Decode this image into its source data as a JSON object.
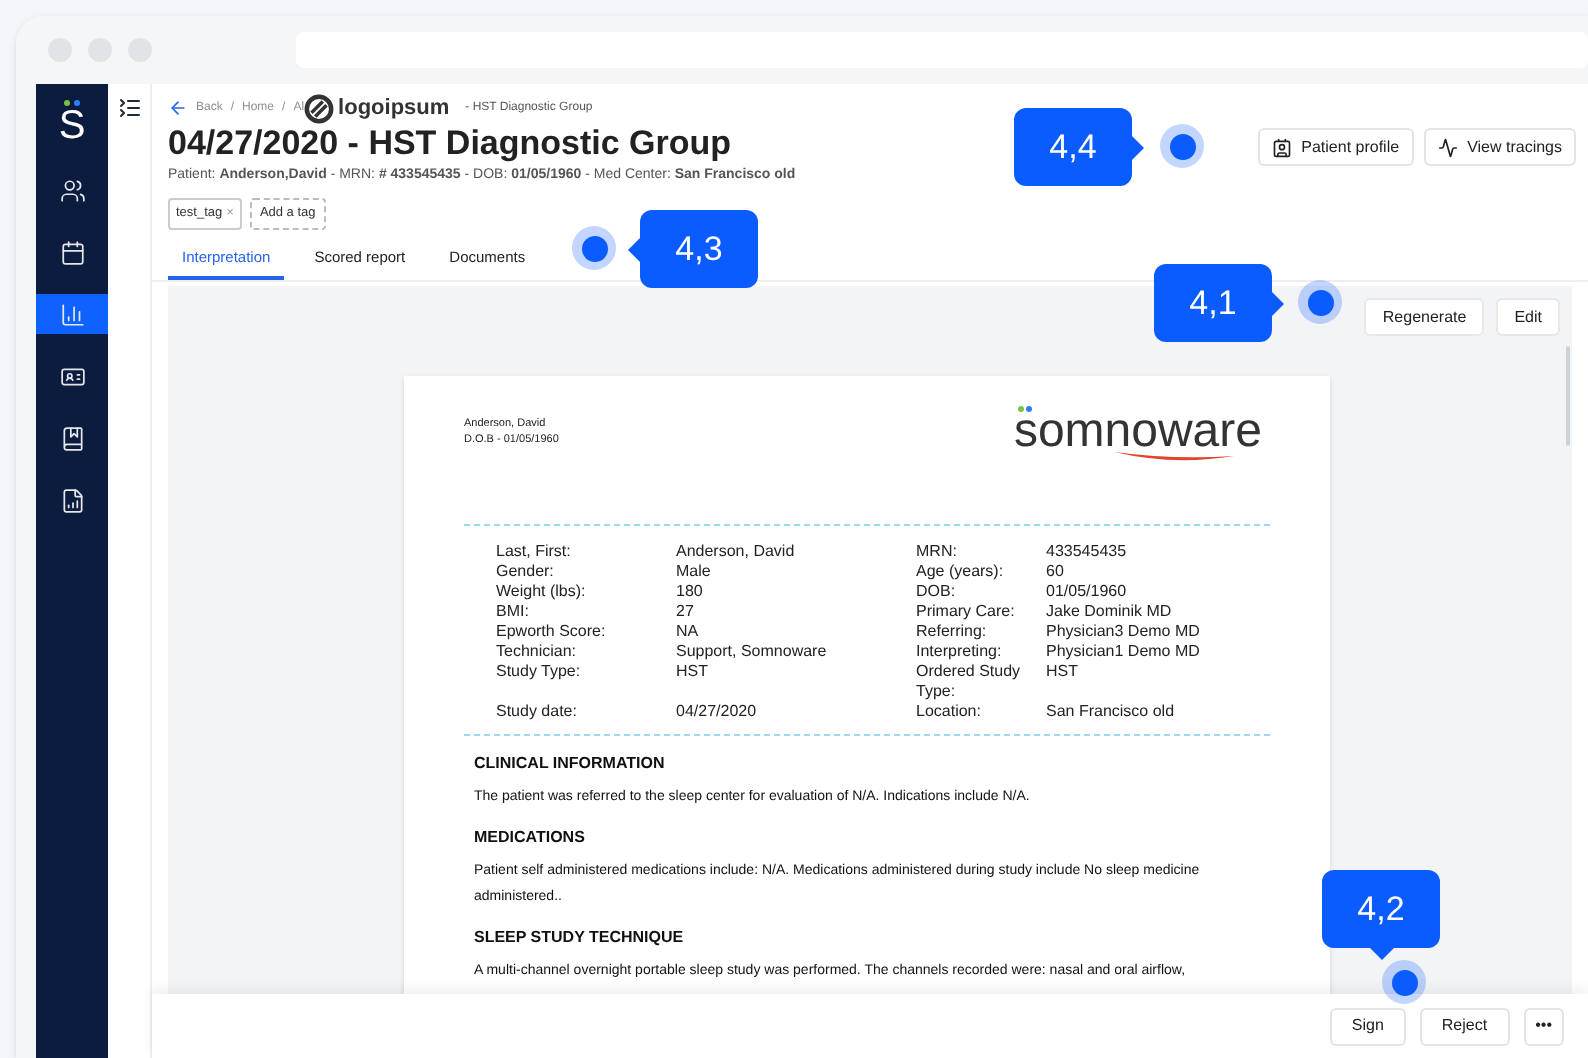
{
  "sidebar": {
    "logo_letter": "S",
    "items": [
      {
        "selected": false
      },
      {
        "selected": false
      },
      {
        "selected": true
      },
      {
        "selected": false
      },
      {
        "selected": false
      },
      {
        "selected": false
      }
    ]
  },
  "breadcrumb": {
    "back": "Back",
    "items": [
      {
        "separator": "/",
        "label": "Home"
      },
      {
        "separator": "/",
        "label": "Al"
      }
    ],
    "logo": "logoipsum",
    "tail": "- HST Diagnostic Group"
  },
  "title": "04/27/2020 - HST Diagnostic Group",
  "patient_line": "Patient: **Anderson,David** - MRN: **# 433545435** - DOB: **01/05/1960** - Med Center: **San Francisco old**",
  "tags": [
    {
      "label": "test_tag",
      "remove": "×"
    }
  ],
  "add_tag": "Add a tag",
  "header_buttons": [
    "Patient profile",
    "View tracings"
  ],
  "tabs": [
    {
      "label": "Interpretation",
      "selected": true
    },
    {
      "label": "Scored report",
      "selected": false
    },
    {
      "label": "Documents",
      "selected": false
    }
  ],
  "toolbar_buttons": [
    "Regenerate",
    "Edit"
  ],
  "report": {
    "patient_name": "Anderson, David",
    "dob": "D.O.B - 01/05/1960",
    "brand": "somnoware",
    "left_fields": [
      {
        "label": "Last, First:",
        "value": "Anderson, David"
      },
      {
        "label": "Gender:",
        "value": "Male"
      },
      {
        "label": "Weight (lbs):",
        "value": "180"
      },
      {
        "label": "BMI:",
        "value": "27"
      },
      {
        "label": "Epworth Score:",
        "value": "NA"
      },
      {
        "label": "Technician:",
        "value": "Support, Somnoware"
      },
      {
        "label": "Study Type:",
        "value": "HST"
      },
      {
        "label": "Study date:",
        "value": "04/27/2020"
      }
    ],
    "right_fields": [
      {
        "label": "MRN:",
        "value": "433545435"
      },
      {
        "label": "Age (years):",
        "value": "60"
      },
      {
        "label": "DOB:",
        "value": "01/05/1960"
      },
      {
        "label": "Primary Care:",
        "value": "Jake Dominik MD"
      },
      {
        "label": "Referring:",
        "value": "Physician3 Demo MD"
      },
      {
        "label": "Interpreting:",
        "value": "Physician1 Demo MD"
      },
      {
        "label": "Ordered Study Type:",
        "value": "HST"
      },
      {
        "label": "Location:",
        "value": "San Francisco old"
      }
    ],
    "sections": [
      {
        "heading": "CLINICAL INFORMATION",
        "text": "The patient was referred to the sleep center for evaluation of N/A. Indications include N/A."
      },
      {
        "heading": "MEDICATIONS",
        "text": "Patient self administered medications include: N/A. Medications administered during study include No sleep medicine administered.."
      },
      {
        "heading": "SLEEP STUDY TECHNIQUE",
        "text": "A multi-channel overnight portable sleep study was performed. The channels recorded were: nasal and oral airflow,"
      }
    ]
  },
  "footer_buttons": [
    {
      "label": "Sign",
      "kind": "text"
    },
    {
      "label": "Reject",
      "kind": "text"
    },
    {
      "label": "•••",
      "kind": "more"
    }
  ],
  "callouts": [
    "4,4",
    "4,3",
    "4,1",
    "4,2"
  ]
}
